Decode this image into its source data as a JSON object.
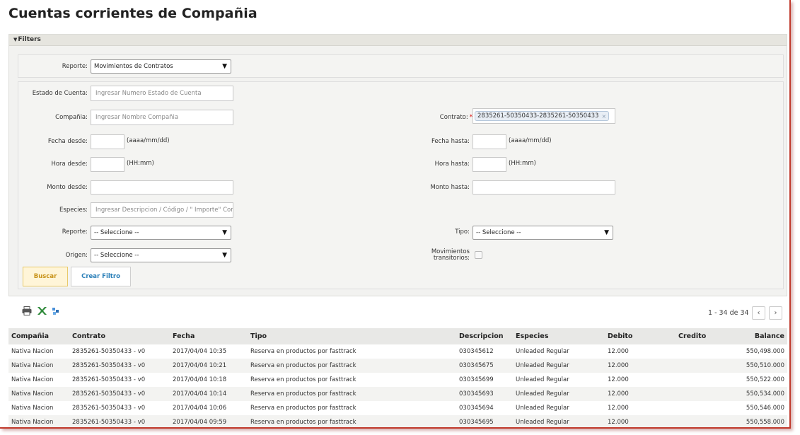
{
  "page": {
    "title": "Cuentas corrientes de Compañia"
  },
  "filters": {
    "header": "Filters",
    "reporte_top": {
      "label": "Reporte:",
      "value": "Movimientos de Contratos"
    },
    "estado_cuenta": {
      "label": "Estado de Cuenta:",
      "placeholder": "Ingresar Numero Estado de Cuenta"
    },
    "compania": {
      "label": "Compañia:",
      "placeholder": "Ingresar Nombre Compañia"
    },
    "contrato": {
      "label": "Contrato:",
      "required_mark": "*",
      "tag": "2835261-50350433-2835261-50350433",
      "tag_remove": "×"
    },
    "fecha_desde": {
      "label": "Fecha desde:",
      "hint": "(aaaa/mm/dd)"
    },
    "fecha_hasta": {
      "label": "Fecha hasta:",
      "hint": "(aaaa/mm/dd)"
    },
    "hora_desde": {
      "label": "Hora desde:",
      "hint": "(HH:mm)"
    },
    "hora_hasta": {
      "label": "Hora hasta:",
      "hint": "(HH:mm)"
    },
    "monto_desde": {
      "label": "Monto desde:"
    },
    "monto_hasta": {
      "label": "Monto hasta:"
    },
    "especies": {
      "label": "Especies:",
      "placeholder": "Ingresar Descripcion / Código / \" Importe\" Comb"
    },
    "reporte": {
      "label": "Reporte:",
      "value": "-- Seleccione --"
    },
    "tipo": {
      "label": "Tipo:",
      "value": "-- Seleccione --"
    },
    "origen": {
      "label": "Origen:",
      "value": "-- Seleccione --"
    },
    "movimientos": {
      "label_line1": "Movimientos",
      "label_line2": "transitorios:"
    },
    "buscar_label": "Buscar",
    "crear_filtro_label": "Crear Filtro"
  },
  "toolbar": {
    "icons": [
      "printer-icon",
      "excel-export-icon",
      "refresh-icon"
    ]
  },
  "pager": {
    "text": "1 - 34 de 34",
    "prev": "‹",
    "next": "›"
  },
  "table": {
    "columns": [
      "Compañia",
      "Contrato",
      "Fecha",
      "Tipo",
      "Descripcion",
      "Especies",
      "Debito",
      "Credito",
      "Balance"
    ],
    "rows": [
      [
        "Nativa Nacion",
        "2835261-50350433 - v0",
        "2017/04/04 10:35",
        "Reserva en productos por fasttrack",
        "030345612",
        "Unleaded Regular",
        "12.000",
        "",
        "550,498.000"
      ],
      [
        "Nativa Nacion",
        "2835261-50350433 - v0",
        "2017/04/04 10:21",
        "Reserva en productos por fasttrack",
        "030345675",
        "Unleaded Regular",
        "12.000",
        "",
        "550,510.000"
      ],
      [
        "Nativa Nacion",
        "2835261-50350433 - v0",
        "2017/04/04 10:18",
        "Reserva en productos por fasttrack",
        "030345699",
        "Unleaded Regular",
        "12.000",
        "",
        "550,522.000"
      ],
      [
        "Nativa Nacion",
        "2835261-50350433 - v0",
        "2017/04/04 10:14",
        "Reserva en productos por fasttrack",
        "030345693",
        "Unleaded Regular",
        "12.000",
        "",
        "550,534.000"
      ],
      [
        "Nativa Nacion",
        "2835261-50350433 - v0",
        "2017/04/04 10:06",
        "Reserva en productos por fasttrack",
        "030345694",
        "Unleaded Regular",
        "12.000",
        "",
        "550,546.000"
      ],
      [
        "Nativa Nacion",
        "2835261-50350433 - v0",
        "2017/04/04 09:59",
        "Reserva en productos por fasttrack",
        "030345695",
        "Unleaded Regular",
        "12.000",
        "",
        "550,558.000"
      ]
    ]
  }
}
